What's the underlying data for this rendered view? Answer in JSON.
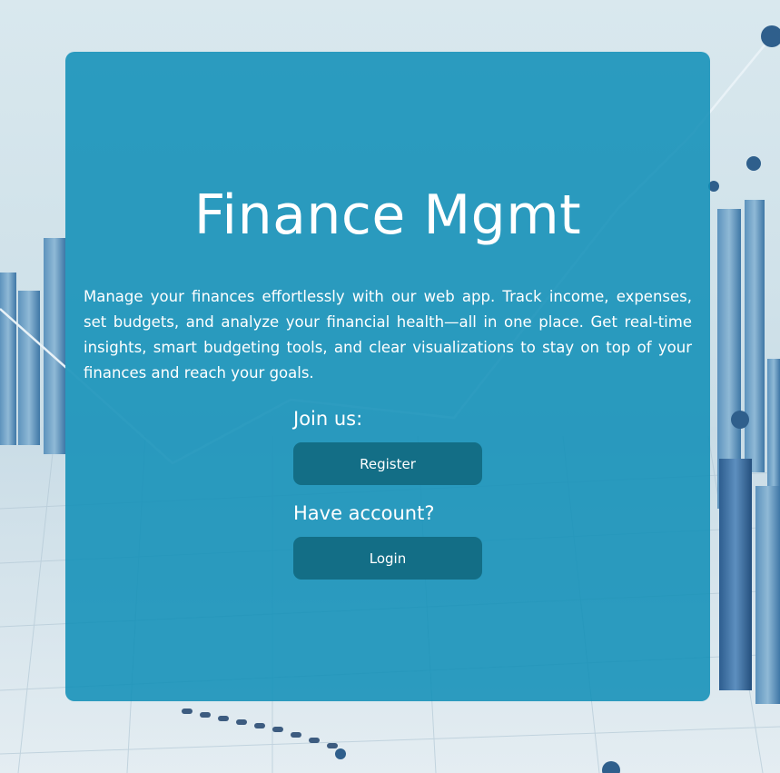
{
  "app": {
    "title": "Finance Mgmt",
    "description": "Manage your finances effortlessly with our web app. Track income, expenses, set budgets, and analyze your financial health—all in one place. Get real-time insights, smart budgeting tools, and clear visualizations to stay on top of your finances and reach your goals."
  },
  "register_section": {
    "label": "Join us:",
    "button_label": "Register"
  },
  "login_section": {
    "label": "Have account?",
    "button_label": "Login"
  },
  "background": {
    "image": "financial-bar-chart-illustration"
  },
  "colors": {
    "card": "#0e8eb7",
    "button": "#136e86",
    "text": "#ffffff"
  }
}
